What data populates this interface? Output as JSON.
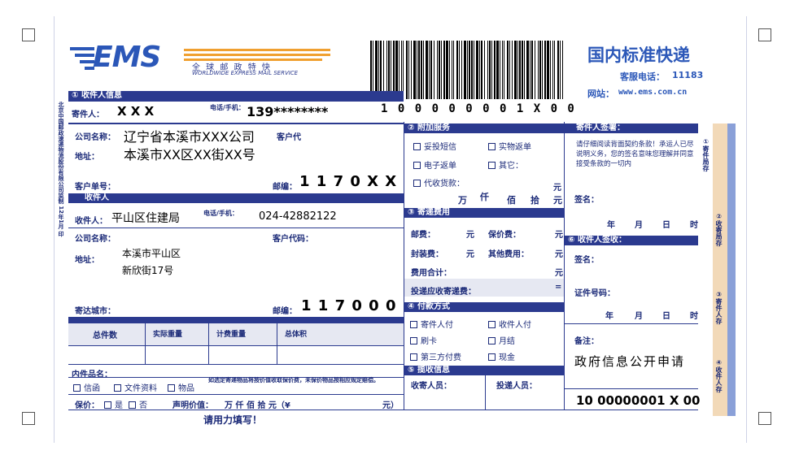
{
  "header": {
    "logo_text": "EMS",
    "logo_cn": "全 球 邮 政 特 快",
    "logo_en": "WORLDWIDE EXPRESS MAIL SERVICE",
    "title": "国内标准快递",
    "hotline_label": "客服电话：",
    "hotline": "11183",
    "website_label": "网站：",
    "website": "www.ems.com.cn",
    "tracking_number": "1 0 0 0 0 0 0 0 1 X 0 0"
  },
  "sender": {
    "section_label": "① 收件人信息",
    "name_label": "寄件人：",
    "name": "X X X",
    "phone_label": "电话/手机：",
    "phone": "139********",
    "company_label": "公司名称：",
    "company": "辽宁省本溪市XXX公司",
    "customer_code_label": "客户代",
    "address_label": "地址：",
    "address": "本溪市XX区XX街XX号",
    "customer_no_label": "客户单号：",
    "postcode_label": "邮编：",
    "postcode": "1 1 7 0 X X"
  },
  "recipient": {
    "section_label": "收件人",
    "name_label": "收件人：",
    "name": "平山区住建局",
    "phone_label": "电话/手机：",
    "phone": "024-42882122",
    "company_label": "公司名称：",
    "customer_code_label": "客户代码：",
    "address_label": "地址：",
    "address_line1": "本溪市平山区",
    "address_line2": "新欣街17号",
    "city_label": "寄达城市：",
    "postcode_label": "邮编：",
    "postcode": "1 1 7 0 0 0"
  },
  "contents": {
    "cols": [
      "总件数",
      "实际重量",
      "计费重量",
      "总体积"
    ],
    "item_label": "内件品名：",
    "types": [
      "信函",
      "文件资料",
      "物品"
    ],
    "notice": "如选定寄递物品将按价值收取保价费，未保价物品按相应规定赔偿。",
    "insured_label": "保价：",
    "yes": "是",
    "no": "否",
    "declared_label": "声明价值：",
    "units": "万  仟  佰  拾  元（¥",
    "yuan": "元）",
    "footer": "请用力填写！"
  },
  "services": {
    "section_label": "② 附加服务",
    "items": [
      "妥投短信",
      "实物返单",
      "电子返单",
      "其它：",
      "代收货款："
    ],
    "yuan": "元",
    "units": [
      "万",
      "仟",
      "佰",
      "拾",
      "元"
    ]
  },
  "fees": {
    "section_label": "③ 寄递费用",
    "postage_label": "邮费：",
    "insurance_label": "保价费：",
    "packing_label": "封装费：",
    "other_label": "其他费用：",
    "total_label": "费用合计：",
    "return_label": "投递应收寄递费：",
    "yuan": "元",
    "eq": "="
  },
  "payment": {
    "section_label": "④ 付款方式",
    "options": [
      "寄件人付",
      "收件人付",
      "刷卡",
      "月结",
      "第三方付费",
      "现金"
    ]
  },
  "acceptance": {
    "section_label": "⑤ 揽收信息",
    "collector_label": "收寄人员：",
    "deliverer_label": "投递人员："
  },
  "sender_sign": {
    "section_label": "寄件人签署：",
    "text": "请仔细阅读背面契约条款！承运人已尽说明义务，您的签名意味您理解并同意接受条款的一切内",
    "sign_label": "签名：",
    "year": "年",
    "month": "月",
    "day": "日",
    "hour": "时"
  },
  "recipient_sign": {
    "section_label": "⑥ 收件人签收：",
    "sign_label": "签名：",
    "id_label": "证件号码：",
    "year": "年",
    "month": "月",
    "day": "日",
    "hour": "时"
  },
  "remarks": {
    "label": "备注：",
    "text": "政府信息公开申请",
    "barcode_number": "10 00000001 X 00"
  },
  "side_tabs": [
    "①寄件局存",
    "②收寄局存",
    "③寄件人存",
    "④收件人存"
  ],
  "left_vertical": "北京中国邮政速递物流股份有限公司监制 12年1月 印"
}
